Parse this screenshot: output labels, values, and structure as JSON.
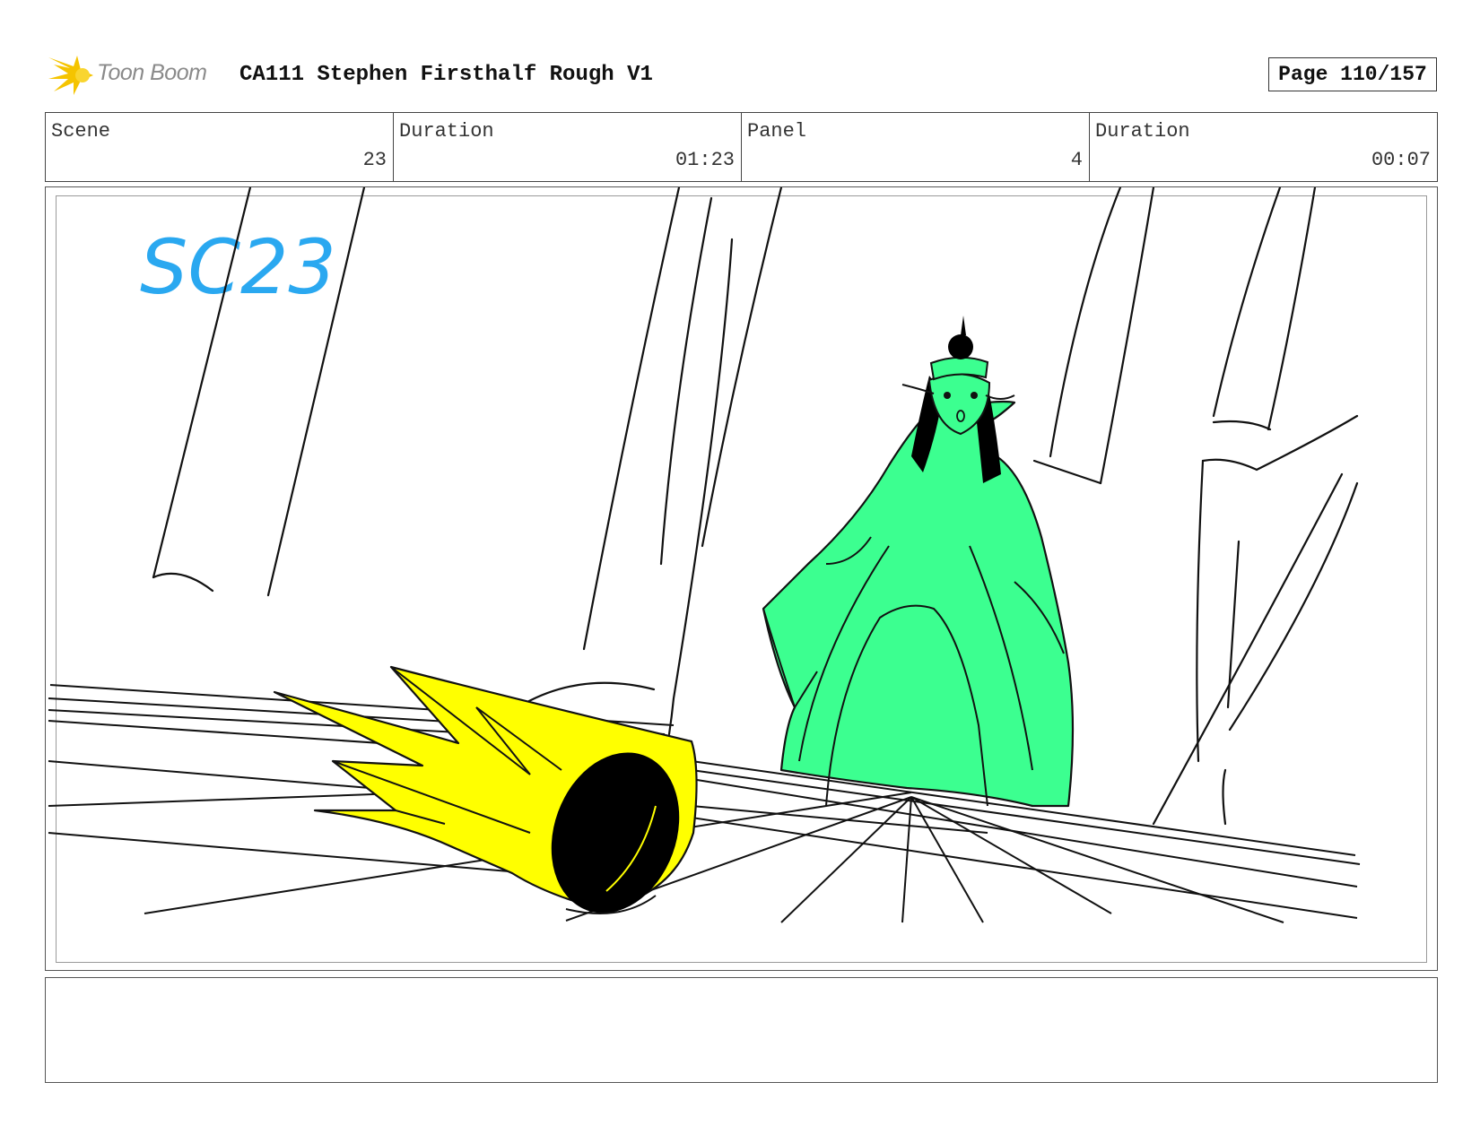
{
  "header": {
    "brand": "Toon Boom",
    "title": "CA111 Stephen Firsthalf Rough V1",
    "page": "Page 110/157"
  },
  "info": {
    "scene_label": "Scene",
    "scene_value": "23",
    "scene_duration_label": "Duration",
    "scene_duration_value": "01:23",
    "panel_label": "Panel",
    "panel_value": "4",
    "panel_duration_label": "Duration",
    "panel_duration_value": "00:07"
  },
  "panel": {
    "scene_annotation": "SC23"
  },
  "colors": {
    "logo_yellow": "#f5c400",
    "annotation_blue": "#2aa8f0",
    "crown_yellow": "#ffff00",
    "figure_green": "#3cff90"
  }
}
